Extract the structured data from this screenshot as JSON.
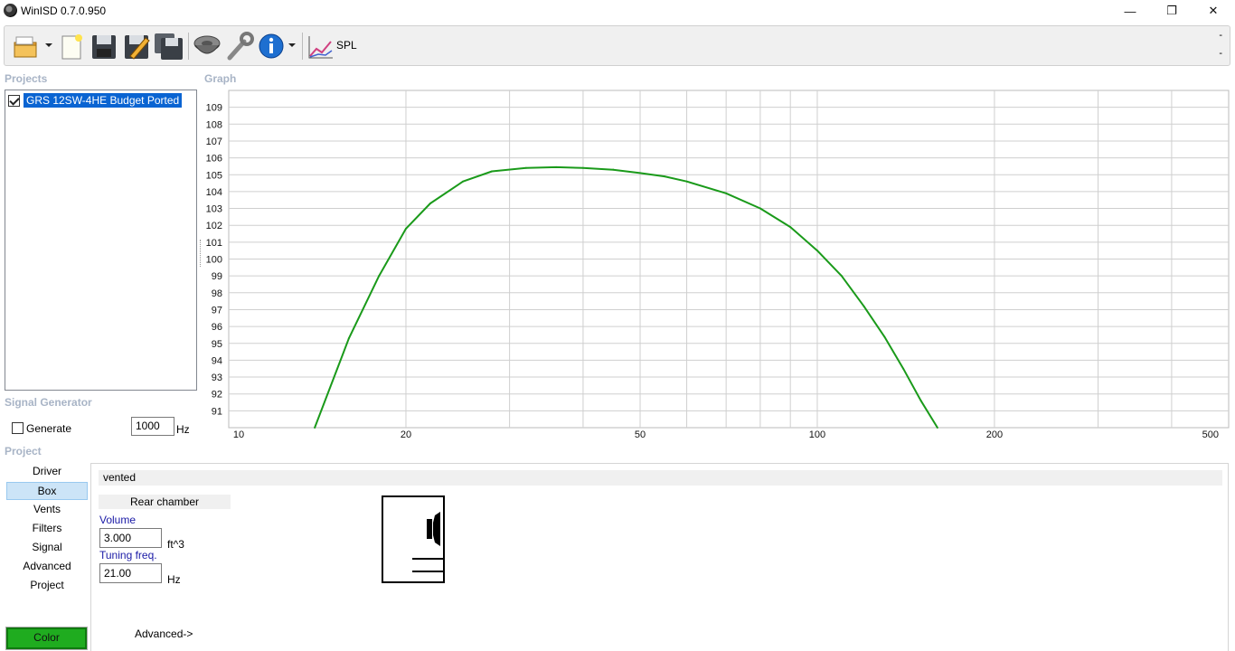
{
  "window": {
    "title": "WinISD 0.7.0.950",
    "minimize_glyph": "—",
    "maximize_glyph": "❐",
    "close_glyph": "✕"
  },
  "toolbar": {
    "buttons": [
      "open-folder-icon",
      "new-project-icon",
      "save-icon",
      "save-as-icon",
      "save-all-icon",
      "driver-editor-icon",
      "tools-wrench-icon",
      "info-icon",
      "spl-graph-icon"
    ],
    "spl_label": "SPL",
    "dash_top": "-",
    "dash_bottom": "-"
  },
  "projects": {
    "label": "Projects",
    "items": [
      {
        "name": "GRS 12SW-4HE Budget Ported",
        "checked": true,
        "selected": true
      }
    ]
  },
  "graph": {
    "label": "Graph"
  },
  "chart_data": {
    "type": "line",
    "title": "",
    "xlabel": "",
    "ylabel": "",
    "xscale": "log",
    "xlim": [
      10,
      500
    ],
    "ylim": [
      90,
      110
    ],
    "x_tick_labels": [
      "10",
      "20",
      "50",
      "100",
      "200",
      "500"
    ],
    "x_tick_values": [
      10,
      20,
      50,
      100,
      200,
      500
    ],
    "y_tick_labels": [
      "109",
      "108",
      "107",
      "106",
      "105",
      "104",
      "103",
      "102",
      "101",
      "100",
      "99",
      "98",
      "97",
      "96",
      "95",
      "94",
      "93",
      "92",
      "91"
    ],
    "y_tick_values": [
      109,
      108,
      107,
      106,
      105,
      104,
      103,
      102,
      101,
      100,
      99,
      98,
      97,
      96,
      95,
      94,
      93,
      92,
      91
    ],
    "grid": true,
    "series": [
      {
        "color": "#1a9a1a",
        "x": [
          14,
          16,
          18,
          20,
          22,
          25,
          28,
          32,
          36,
          40,
          45,
          50,
          55,
          60,
          70,
          80,
          90,
          100,
          110,
          120,
          130,
          140,
          150,
          160
        ],
        "y": [
          90.0,
          95.3,
          99.0,
          101.8,
          103.3,
          104.6,
          105.2,
          105.4,
          105.45,
          105.4,
          105.3,
          105.1,
          104.9,
          104.6,
          103.9,
          103.0,
          101.9,
          100.5,
          99.0,
          97.2,
          95.4,
          93.5,
          91.6,
          90.0
        ]
      }
    ]
  },
  "signal_generator": {
    "label": "Signal Generator",
    "generate_label": "Generate",
    "generate_checked": false,
    "frequency": "1000",
    "unit": "Hz"
  },
  "project": {
    "label": "Project",
    "nav": [
      "Driver",
      "Box",
      "Vents",
      "Filters",
      "Signal",
      "Advanced",
      "Project"
    ],
    "active_nav": "Box",
    "color_button": "Color",
    "color_value": "#1fac1f"
  },
  "box": {
    "type": "vented",
    "rear_chamber_label": "Rear chamber",
    "volume_label": "Volume",
    "volume_value": "3.000",
    "volume_unit": "ft^3",
    "tuning_label": "Tuning freq.",
    "tuning_value": "21.00",
    "tuning_unit": "Hz",
    "advanced_link": "Advanced->"
  }
}
